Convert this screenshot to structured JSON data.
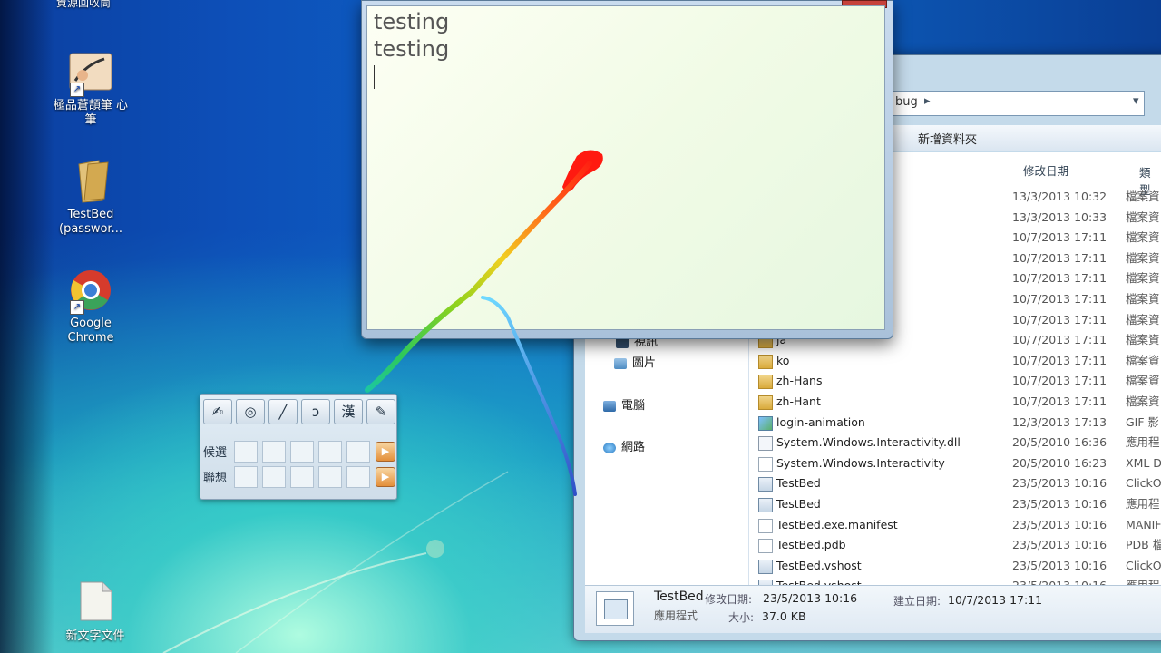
{
  "desktop": {
    "top_label": "資源回收筒",
    "icons": [
      {
        "label": "極品蒼頡筆 心筆",
        "icon": "handwriting-pen-icon"
      },
      {
        "label": "TestBed (passwor...",
        "icon": "folder-icon"
      },
      {
        "label": "Google Chrome",
        "icon": "chrome-icon"
      },
      {
        "label": "新文字文件",
        "icon": "text-document-icon"
      }
    ]
  },
  "ink_window": {
    "lines": [
      "testing",
      "testing"
    ]
  },
  "explorer": {
    "address_tail": "bug",
    "toolbar_new_folder": "新增資料夾",
    "columns": {
      "date": "修改日期",
      "type": "類型"
    },
    "nav": [
      {
        "label": "視訊",
        "icon": "video-icon"
      },
      {
        "label": "圖片",
        "icon": "pictures-icon"
      },
      {
        "label": "電腦",
        "icon": "computer-icon"
      },
      {
        "label": "網路",
        "icon": "network-icon"
      }
    ],
    "rows": [
      {
        "name": "",
        "date": "13/3/2013 10:32",
        "type": "檔案資",
        "kind": "folder"
      },
      {
        "name": "",
        "date": "13/3/2013 10:33",
        "type": "檔案資",
        "kind": "folder"
      },
      {
        "name": "",
        "date": "10/7/2013 17:11",
        "type": "檔案資",
        "kind": "folder"
      },
      {
        "name": "",
        "date": "10/7/2013 17:11",
        "type": "檔案資",
        "kind": "folder"
      },
      {
        "name": "",
        "date": "10/7/2013 17:11",
        "type": "檔案資",
        "kind": "folder"
      },
      {
        "name": "",
        "date": "10/7/2013 17:11",
        "type": "檔案資",
        "kind": "folder"
      },
      {
        "name": "",
        "date": "10/7/2013 17:11",
        "type": "檔案資",
        "kind": "folder"
      },
      {
        "name": "ja",
        "date": "10/7/2013 17:11",
        "type": "檔案資",
        "kind": "folder"
      },
      {
        "name": "ko",
        "date": "10/7/2013 17:11",
        "type": "檔案資",
        "kind": "folder"
      },
      {
        "name": "zh-Hans",
        "date": "10/7/2013 17:11",
        "type": "檔案資",
        "kind": "folder"
      },
      {
        "name": "zh-Hant",
        "date": "10/7/2013 17:11",
        "type": "檔案資",
        "kind": "folder"
      },
      {
        "name": "login-animation",
        "date": "12/3/2013 17:13",
        "type": "GIF 影",
        "kind": "gif"
      },
      {
        "name": "System.Windows.Interactivity.dll",
        "date": "20/5/2010 16:36",
        "type": "應用程",
        "kind": "dll"
      },
      {
        "name": "System.Windows.Interactivity",
        "date": "20/5/2010 16:23",
        "type": "XML D",
        "kind": "file"
      },
      {
        "name": "TestBed",
        "date": "23/5/2013 10:16",
        "type": "ClickOn",
        "kind": "exe"
      },
      {
        "name": "TestBed",
        "date": "23/5/2013 10:16",
        "type": "應用程",
        "kind": "exe"
      },
      {
        "name": "TestBed.exe.manifest",
        "date": "23/5/2013 10:16",
        "type": "MANIFE",
        "kind": "file"
      },
      {
        "name": "TestBed.pdb",
        "date": "23/5/2013 10:16",
        "type": "PDB 檔",
        "kind": "file"
      },
      {
        "name": "TestBed.vshost",
        "date": "23/5/2013 10:16",
        "type": "ClickOn",
        "kind": "exe"
      },
      {
        "name": "TestBed.vshost",
        "date": "23/5/2013 10:16",
        "type": "應用程",
        "kind": "exe"
      }
    ],
    "details": {
      "name": "TestBed",
      "type": "應用程式",
      "modified_label": "修改日期:",
      "modified": "23/5/2013 10:16",
      "created_label": "建立日期:",
      "created": "10/7/2013 17:11",
      "size_label": "大小:",
      "size": "37.0 KB"
    }
  },
  "ime_panel": {
    "tools": [
      {
        "glyph": "✍",
        "icon": "handwriting-icon"
      },
      {
        "glyph": "◎",
        "icon": "eraser-icon"
      },
      {
        "glyph": "╱",
        "icon": "pen-icon"
      },
      {
        "glyph": "ɔ",
        "icon": "stroke-icon"
      },
      {
        "glyph": "漢",
        "icon": "chinese-char-icon"
      },
      {
        "glyph": "✎",
        "icon": "edit-icon"
      }
    ],
    "row1_label": "候選",
    "row2_label": "聯想"
  }
}
